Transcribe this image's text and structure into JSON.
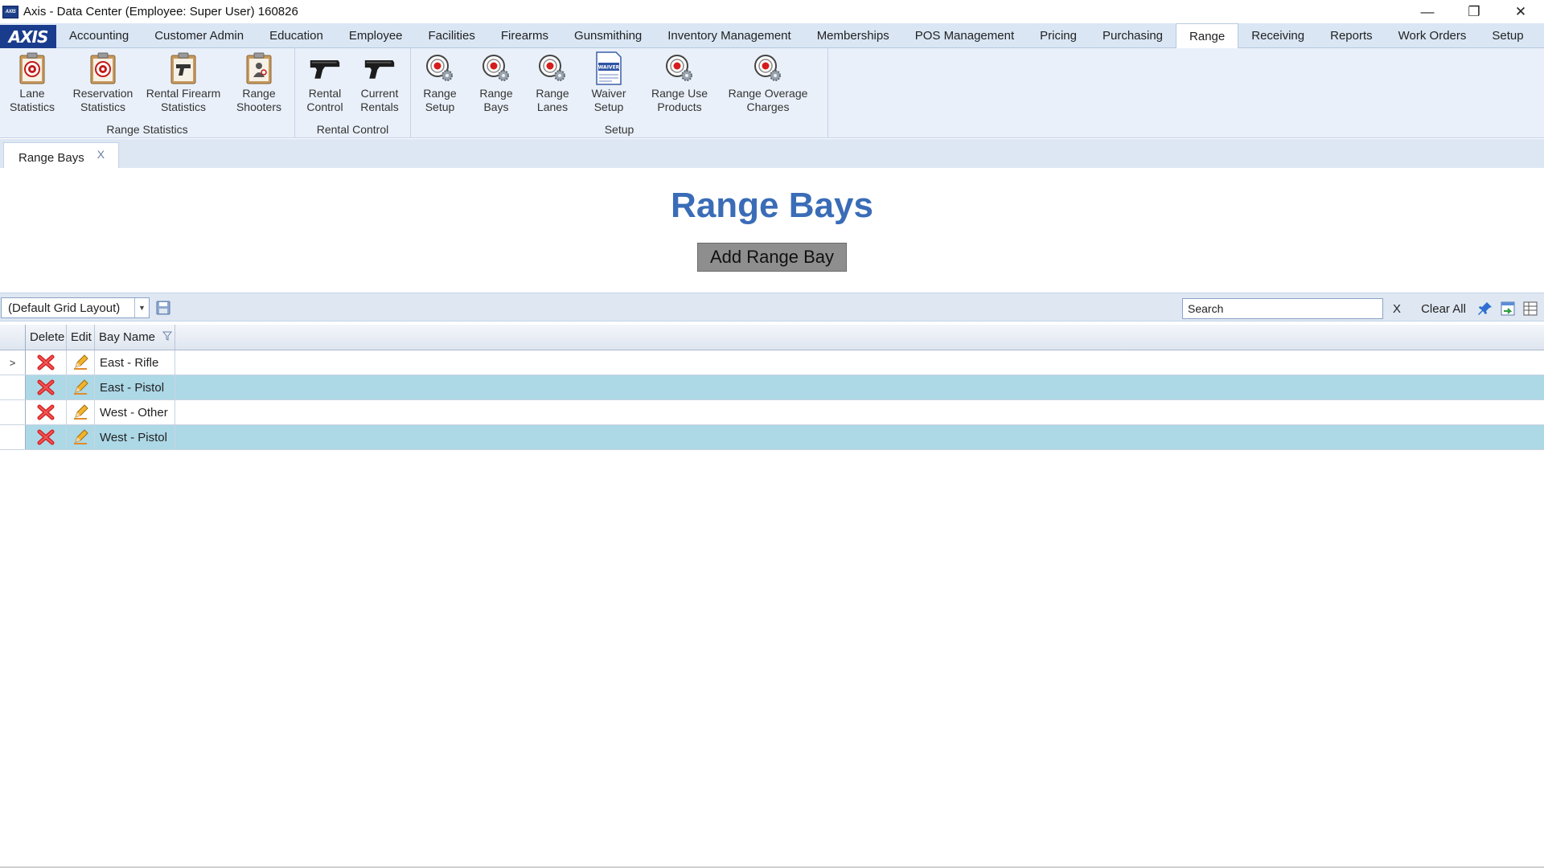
{
  "window": {
    "title": "Axis - Data Center  (Employee: Super User) 160826",
    "app_icon_text": "AXIS",
    "controls": {
      "minimize": "—",
      "restore": "❐",
      "close": "✕"
    }
  },
  "menubar": {
    "logo": "AXIS",
    "items": [
      {
        "label": "Accounting"
      },
      {
        "label": "Customer Admin"
      },
      {
        "label": "Education"
      },
      {
        "label": "Employee"
      },
      {
        "label": "Facilities"
      },
      {
        "label": "Firearms"
      },
      {
        "label": "Gunsmithing"
      },
      {
        "label": "Inventory Management"
      },
      {
        "label": "Memberships"
      },
      {
        "label": "POS Management"
      },
      {
        "label": "Pricing"
      },
      {
        "label": "Purchasing"
      },
      {
        "label": "Range"
      },
      {
        "label": "Receiving"
      },
      {
        "label": "Reports"
      },
      {
        "label": "Work Orders"
      },
      {
        "label": "Setup"
      }
    ],
    "active": "Range"
  },
  "ribbon": {
    "groups": [
      {
        "label": "Range Statistics",
        "buttons": [
          {
            "line1": "Lane",
            "line2": "Statistics",
            "icon": "clipboard-target-icon"
          },
          {
            "line1": "Reservation",
            "line2": "Statistics",
            "icon": "clipboard-target-icon"
          },
          {
            "line1": "Rental Firearm",
            "line2": "Statistics",
            "icon": "clipboard-pistol-icon"
          },
          {
            "line1": "Range",
            "line2": "Shooters",
            "icon": "clipboard-person-icon"
          }
        ]
      },
      {
        "label": "Rental Control",
        "buttons": [
          {
            "line1": "Rental",
            "line2": "Control",
            "icon": "pistol-icon"
          },
          {
            "line1": "Current",
            "line2": "Rentals",
            "icon": "pistol-icon"
          }
        ]
      },
      {
        "label": "Setup",
        "buttons": [
          {
            "line1": "Range",
            "line2": "Setup",
            "icon": "target-gear-icon"
          },
          {
            "line1": "Range",
            "line2": "Bays",
            "icon": "target-gear-icon"
          },
          {
            "line1": "Range",
            "line2": "Lanes",
            "icon": "target-gear-icon"
          },
          {
            "line1": "Waiver",
            "line2": "Setup",
            "icon": "waiver-document-icon",
            "icon_text": "WAIVER"
          },
          {
            "line1": "Range Use",
            "line2": "Products",
            "icon": "target-gear-icon"
          },
          {
            "line1": "Range Overage",
            "line2": "Charges",
            "icon": "target-gear-icon"
          }
        ]
      }
    ]
  },
  "doc_tab": {
    "label": "Range Bays",
    "close": "X"
  },
  "main": {
    "title": "Range Bays",
    "add_button": "Add Range Bay"
  },
  "toolbar": {
    "layout_value": "(Default Grid Layout)",
    "search_value": "Search",
    "search_clear": "X",
    "clear_all": "Clear All"
  },
  "grid": {
    "columns": {
      "delete": "Delete",
      "edit": "Edit",
      "bay_name": "Bay Name"
    },
    "current_row_marker": ">",
    "rows": [
      {
        "bay_name": "East  - Rifle"
      },
      {
        "bay_name": "East - Pistol"
      },
      {
        "bay_name": "West - Other"
      },
      {
        "bay_name": "West - Pistol"
      }
    ]
  },
  "colors": {
    "title_blue": "#3a6cb7",
    "alt_row": "#add8e6",
    "logo_blue": "#1a3c8c",
    "delete_red": "#d62020"
  }
}
